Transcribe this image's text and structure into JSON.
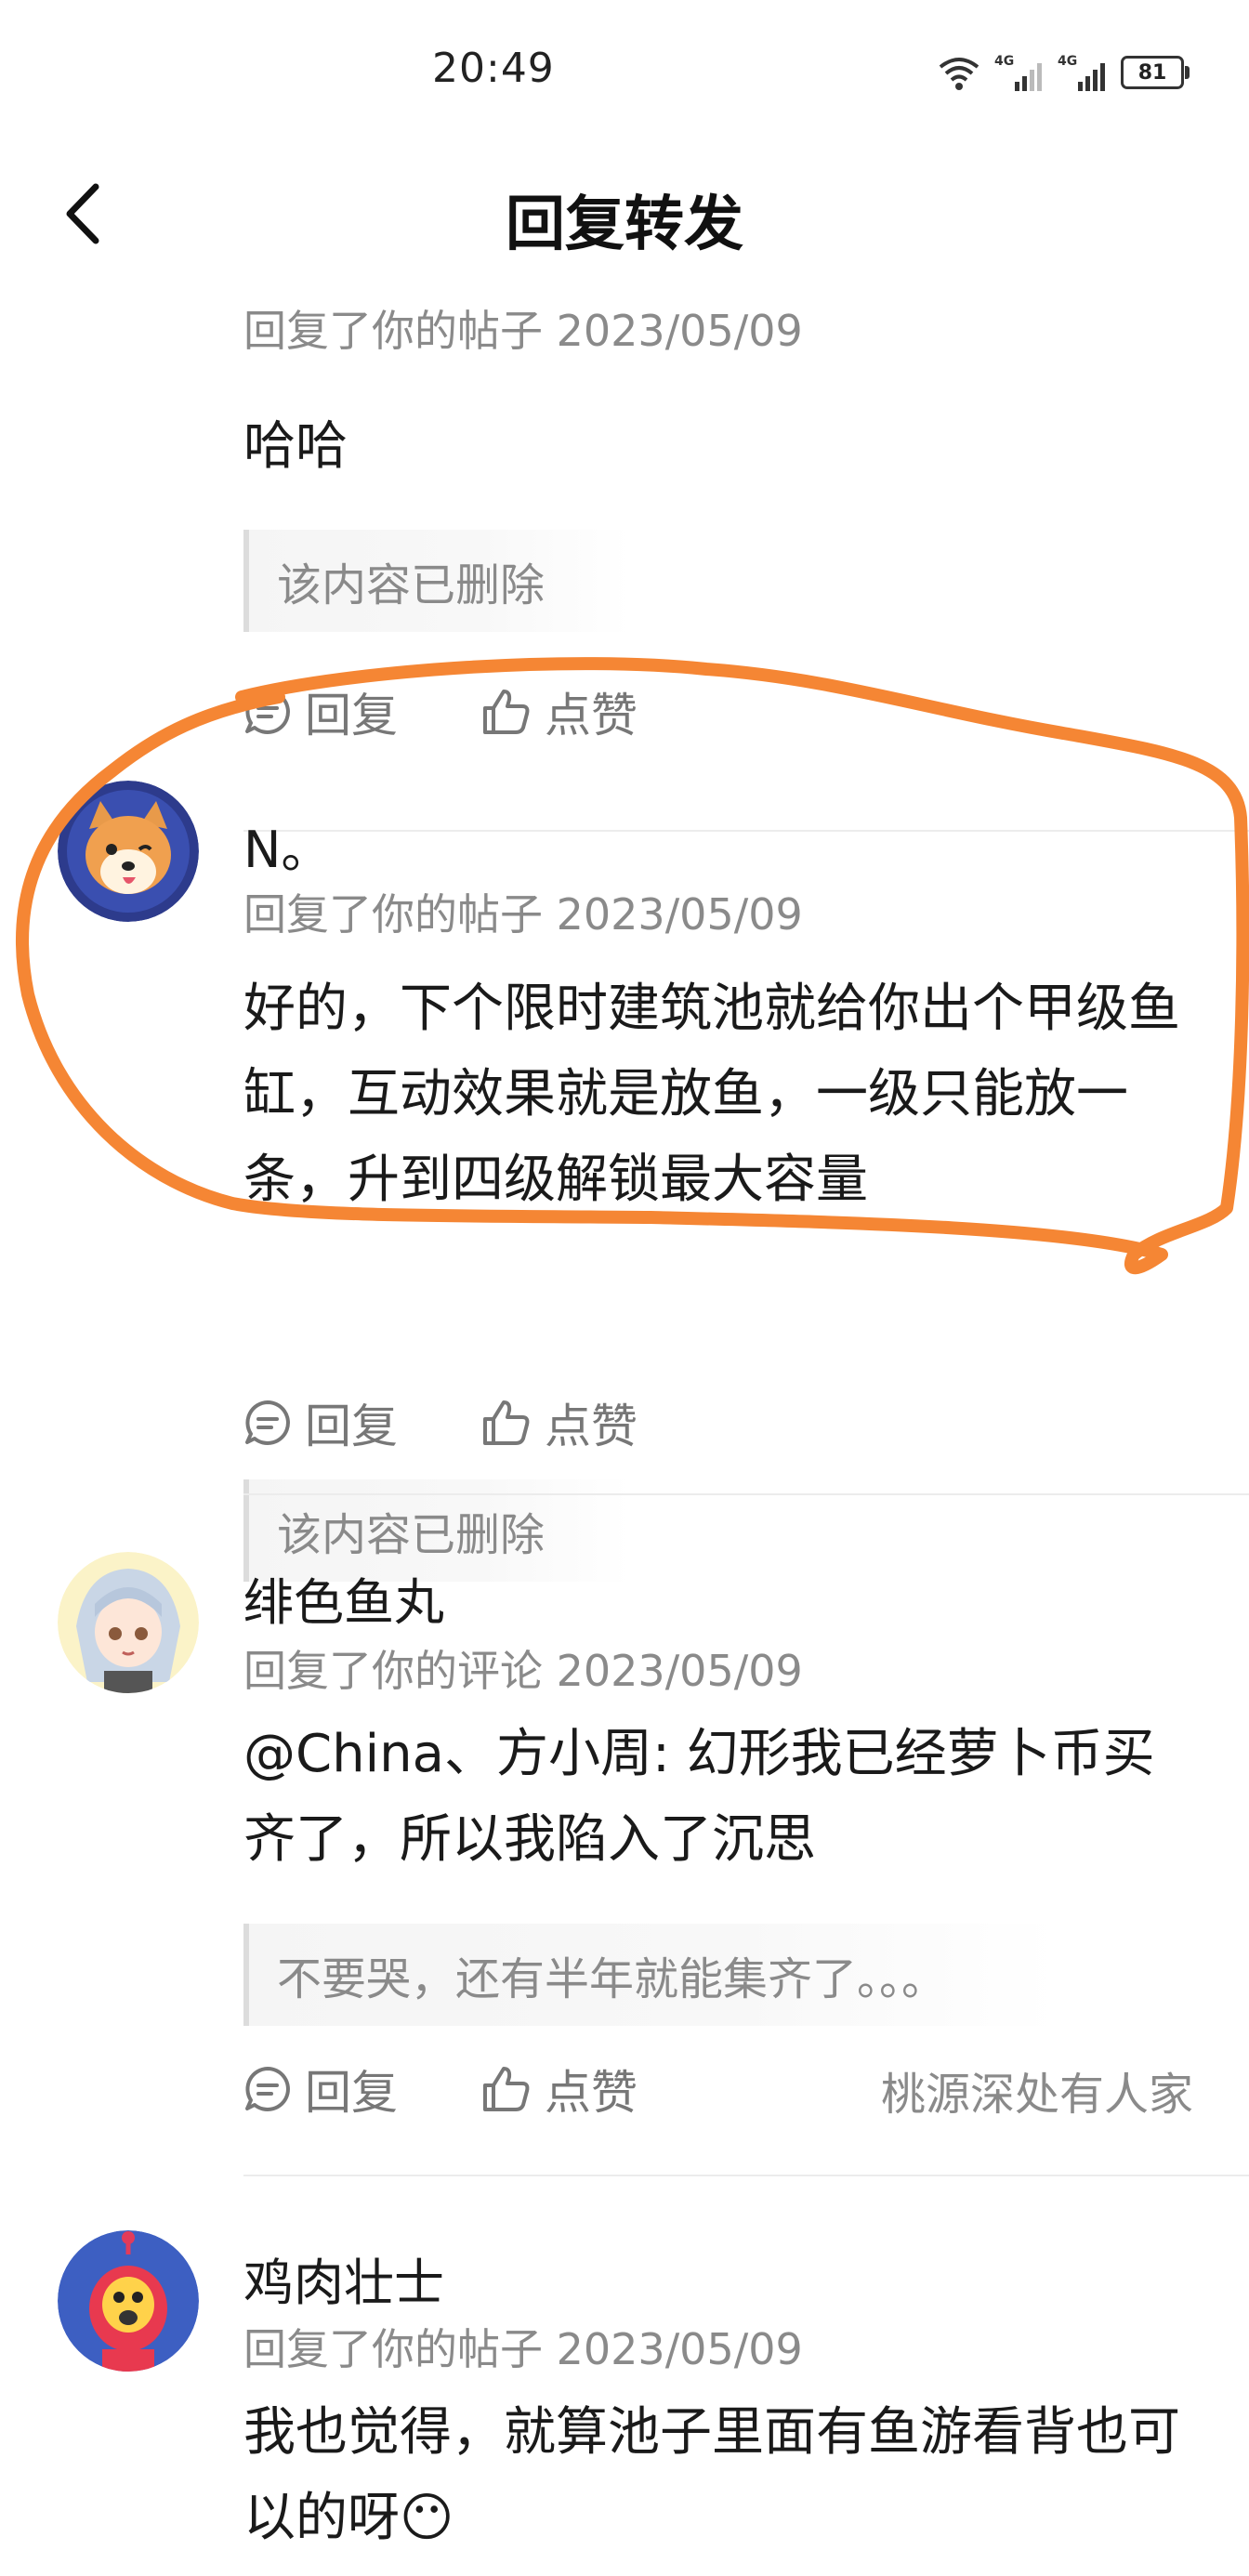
{
  "status_bar": {
    "time": "20:49",
    "signal1": "4G",
    "signal2": "4G",
    "battery": "81"
  },
  "nav": {
    "title": "回复转发"
  },
  "entries": [
    {
      "meta": "回复了你的帖子 2023/05/09",
      "content": "哈哈",
      "quote": "该内容已删除",
      "reply_label": "回复",
      "like_label": "点赞"
    },
    {
      "user": "N。",
      "meta": "回复了你的帖子 2023/05/09",
      "content": "好的，下个限时建筑池就给你出个甲级鱼缸，互动效果就是放鱼，一级只能放一条，升到四级解锁最大容量",
      "quote": "该内容已删除",
      "reply_label": "回复",
      "like_label": "点赞"
    },
    {
      "user": "绯色鱼丸",
      "meta": "回复了你的评论 2023/05/09",
      "content": "@China、方小周: 幻形我已经萝卜币买齐了，所以我陷入了沉思",
      "quote": "不要哭，还有半年就能集齐了。。。",
      "reply_label": "回复",
      "like_label": "点赞",
      "source": "桃源深处有人家"
    },
    {
      "user": "鸡肉壮士",
      "meta": "回复了你的帖子 2023/05/09",
      "content": "我也觉得，就算池子里面有鱼游看背也可以的呀😶"
    }
  ],
  "colors": {
    "annotation": "#f58634",
    "meta_gray": "#8a8a8a",
    "divider": "#ececec"
  },
  "icons": [
    "back-arrow-icon",
    "wifi-icon",
    "signal-icon",
    "battery-icon",
    "comment-icon",
    "thumb-up-icon"
  ]
}
